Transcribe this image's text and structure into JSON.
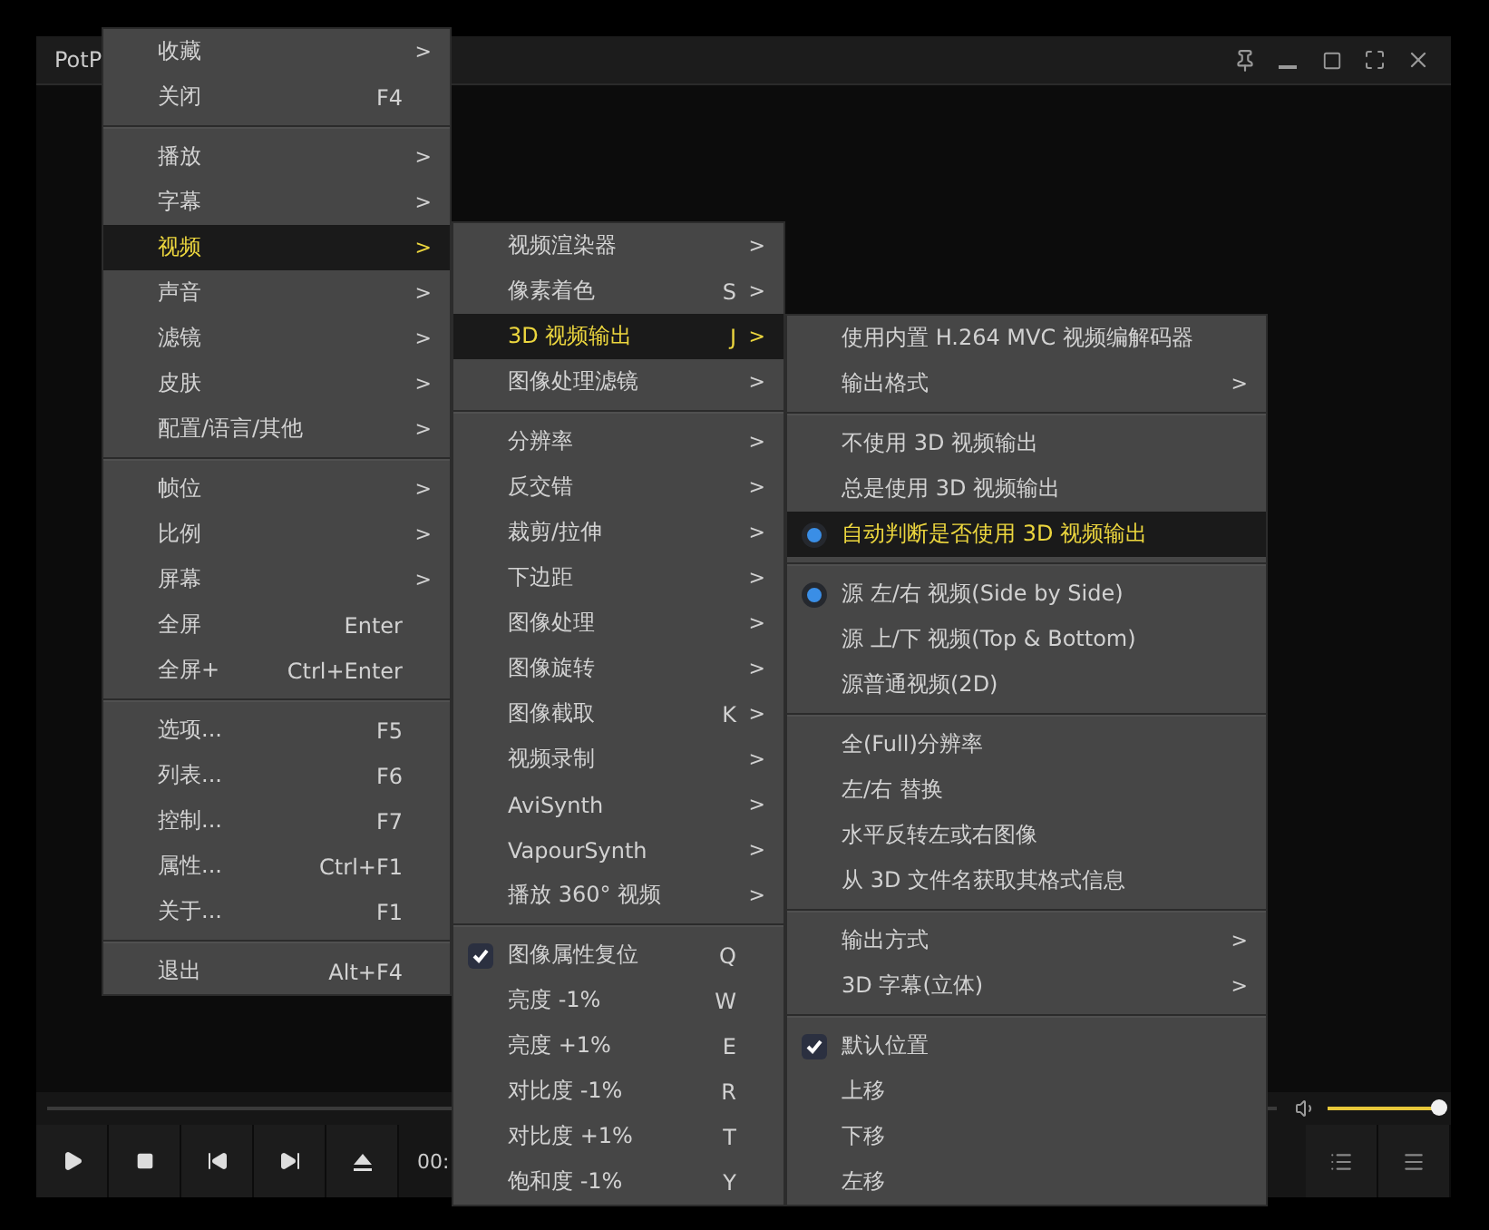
{
  "window": {
    "title": "PotP",
    "time": "00:"
  },
  "volume": {
    "level": 1.0
  },
  "menus": [
    {
      "groups": [
        {
          "kind": "plain",
          "items": [
            {
              "label": "收藏",
              "arrow": ">",
              "selected": false
            },
            {
              "label": "关闭",
              "shortcut": "F4",
              "selected": false
            }
          ]
        },
        {
          "kind": "plain",
          "items": [
            {
              "label": "播放",
              "arrow": ">",
              "selected": false
            },
            {
              "label": "字幕",
              "arrow": ">",
              "selected": false
            },
            {
              "label": "视频",
              "arrow": ">",
              "selected": true
            },
            {
              "label": "声音",
              "arrow": ">",
              "selected": false
            },
            {
              "label": "滤镜",
              "arrow": ">",
              "selected": false
            },
            {
              "label": "皮肤",
              "arrow": ">",
              "selected": false
            },
            {
              "label": "配置/语言/其他",
              "arrow": ">",
              "selected": false
            }
          ]
        },
        {
          "kind": "plain",
          "items": [
            {
              "label": "帧位",
              "arrow": ">",
              "selected": false
            },
            {
              "label": "比例",
              "arrow": ">",
              "selected": false
            },
            {
              "label": "屏幕",
              "arrow": ">",
              "selected": false
            },
            {
              "label": "全屏",
              "shortcut": "Enter",
              "selected": false
            },
            {
              "label": "全屏+",
              "shortcut": "Ctrl+Enter",
              "selected": false
            }
          ]
        },
        {
          "kind": "plain",
          "items": [
            {
              "label": "选项...",
              "shortcut": "F5",
              "selected": false
            },
            {
              "label": "列表...",
              "shortcut": "F6",
              "selected": false
            },
            {
              "label": "控制...",
              "shortcut": "F7",
              "selected": false
            },
            {
              "label": "属性...",
              "shortcut": "Ctrl+F1",
              "selected": false
            },
            {
              "label": "关于...",
              "shortcut": "F1",
              "selected": false
            }
          ]
        },
        {
          "kind": "plain",
          "items": [
            {
              "label": "退出",
              "shortcut": "Alt+F4",
              "selected": false
            }
          ]
        }
      ]
    },
    {
      "groups": [
        {
          "kind": "plain",
          "items": [
            {
              "label": "视频渲染器",
              "arrow": ">",
              "selected": false
            },
            {
              "label": "像素着色",
              "shortcut": "S",
              "arrow": ">",
              "selected": false
            },
            {
              "label": "3D 视频输出",
              "shortcut": "J",
              "arrow": ">",
              "selected": true
            },
            {
              "label": "图像处理滤镜",
              "arrow": ">",
              "selected": false
            }
          ]
        },
        {
          "kind": "plain",
          "items": [
            {
              "label": "分辨率",
              "arrow": ">",
              "selected": false
            },
            {
              "label": "反交错",
              "arrow": ">",
              "selected": false
            },
            {
              "label": "裁剪/拉伸",
              "arrow": ">",
              "selected": false
            },
            {
              "label": "下边距",
              "arrow": ">",
              "selected": false
            },
            {
              "label": "图像处理",
              "arrow": ">",
              "selected": false
            },
            {
              "label": "图像旋转",
              "arrow": ">",
              "selected": false
            },
            {
              "label": "图像截取",
              "shortcut": "K",
              "arrow": ">",
              "selected": false
            },
            {
              "label": "视频录制",
              "arrow": ">",
              "selected": false
            },
            {
              "label": "AviSynth",
              "arrow": ">",
              "selected": false
            },
            {
              "label": "VapourSynth",
              "arrow": ">",
              "selected": false
            },
            {
              "label": "播放 360° 视频",
              "arrow": ">",
              "selected": false
            }
          ]
        },
        {
          "kind": "check",
          "items": [
            {
              "label": "图像属性复位",
              "shortcut": "Q",
              "selected": false,
              "checked": true
            },
            {
              "label": "亮度 -1%",
              "shortcut": "W",
              "selected": false,
              "checked": false
            },
            {
              "label": "亮度 +1%",
              "shortcut": "E",
              "selected": false,
              "checked": false
            },
            {
              "label": "对比度 -1%",
              "shortcut": "R",
              "selected": false,
              "checked": false
            },
            {
              "label": "对比度 +1%",
              "shortcut": "T",
              "selected": false,
              "checked": false
            },
            {
              "label": "饱和度 -1%",
              "shortcut": "Y",
              "selected": false,
              "checked": false
            }
          ]
        }
      ]
    },
    {
      "groups": [
        {
          "kind": "plain",
          "items": [
            {
              "label": "使用内置 H.264 MVC 视频编解码器",
              "selected": false
            },
            {
              "label": "输出格式",
              "arrow": ">",
              "selected": false
            }
          ]
        },
        {
          "kind": "radio",
          "items": [
            {
              "label": "不使用 3D 视频输出",
              "selected": false,
              "checked": false
            },
            {
              "label": "总是使用 3D 视频输出",
              "selected": false,
              "checked": false
            },
            {
              "label": "自动判断是否使用 3D 视频输出",
              "selected": true,
              "checked": true
            }
          ]
        },
        {
          "kind": "radio",
          "items": [
            {
              "label": "源 左/右 视频(Side by Side)",
              "selected": false,
              "checked": true
            },
            {
              "label": "源 上/下 视频(Top & Bottom)",
              "selected": false,
              "checked": false
            },
            {
              "label": "源普通视频(2D)",
              "selected": false,
              "checked": false
            }
          ]
        },
        {
          "kind": "plain",
          "items": [
            {
              "label": "全(Full)分辨率",
              "selected": false
            },
            {
              "label": "左/右 替换",
              "selected": false
            },
            {
              "label": "水平反转左或右图像",
              "selected": false
            },
            {
              "label": "从 3D 文件名获取其格式信息",
              "selected": false
            }
          ]
        },
        {
          "kind": "plain",
          "items": [
            {
              "label": "输出方式",
              "arrow": ">",
              "selected": false
            },
            {
              "label": "3D 字幕(立体)",
              "arrow": ">",
              "selected": false
            }
          ]
        },
        {
          "kind": "check",
          "items": [
            {
              "label": "默认位置",
              "selected": false,
              "checked": true
            },
            {
              "label": "上移",
              "selected": false,
              "checked": false
            },
            {
              "label": "下移",
              "selected": false,
              "checked": false
            },
            {
              "label": "左移",
              "selected": false,
              "checked": false
            }
          ]
        }
      ]
    }
  ]
}
